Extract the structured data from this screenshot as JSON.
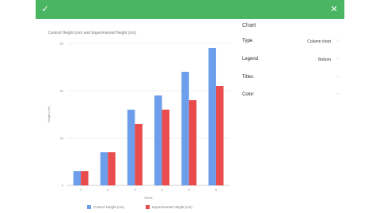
{
  "toolbar": {
    "confirm_icon": "checkmark-icon",
    "close_icon": "close-icon",
    "color": "#4ab563"
  },
  "panel": {
    "title": "Chart",
    "rows": [
      {
        "label": "Type",
        "value": "Column chart"
      },
      {
        "label": "Legend",
        "value": "Bottom"
      },
      {
        "label": "Titles",
        "value": ""
      },
      {
        "label": "Color",
        "value": ""
      }
    ]
  },
  "chart_data": {
    "type": "bar",
    "title": "Control Height (cm) and Experimental Height (cm)",
    "xlabel": "Week",
    "ylabel": "Height (cm)",
    "categories": [
      "1",
      "2",
      "3",
      "4",
      "5",
      "6"
    ],
    "ylim": [
      0,
      60
    ],
    "yticks": [
      0,
      20,
      40,
      60
    ],
    "ytick_labels": [
      "0",
      "20",
      "40",
      "60"
    ],
    "legend_position": "bottom",
    "series": [
      {
        "name": "Control Height (cm)",
        "color": "#6d9eeb",
        "values": [
          6,
          14,
          32,
          38,
          48,
          58
        ]
      },
      {
        "name": "Experimental Height (cm)",
        "color": "#e84c4c",
        "values": [
          6,
          14,
          26,
          32,
          36,
          42
        ]
      }
    ]
  }
}
